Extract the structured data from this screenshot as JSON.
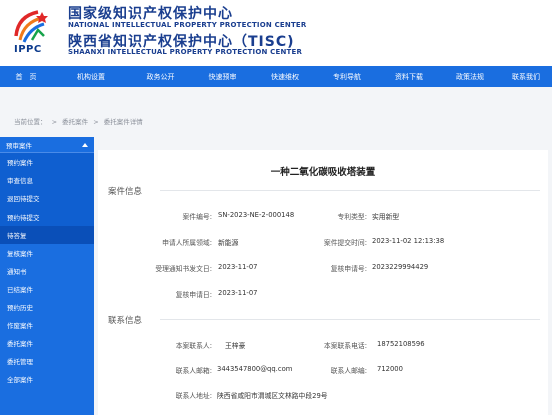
{
  "header": {
    "logo_text": "IPPC",
    "line1": "国家级知识产权保护中心",
    "line2": "NATIONAL INTELLECTUAL PROPERTY PROTECTION CENTER",
    "line3": "陕西省知识产权保护中心（TISC)",
    "line4": "SHAANXI INTELLECTUAL PROPERTY PROTECTION CENTER"
  },
  "nav": [
    "首　页",
    "机构设置",
    "政务公开",
    "快速预审",
    "快速维权",
    "专利导航",
    "资料下载",
    "政策法规",
    "联系我们"
  ],
  "breadcrumb": [
    "当前位置：",
    ">",
    "委托案件",
    ">",
    "委托案件详情"
  ],
  "sidebar": {
    "header": "预审案件",
    "sub_items": [
      "预约案件",
      "审查信息",
      "退回待提交",
      "预约待提交",
      "待答复"
    ],
    "items": [
      "复核案件",
      "通知书",
      "已结案件",
      "预约历史",
      "作废案件",
      "委托案件",
      "委托管理",
      "全部案件"
    ]
  },
  "content": {
    "title": "一种二氧化碳吸收塔装置",
    "case_section": "案件信息",
    "contact_section": "联系信息",
    "case_fields": {
      "case_no_label": "案件编号:",
      "case_no": "SN-2023-NE-2-000148",
      "patent_type_label": "专利类型:",
      "patent_type": "实用新型",
      "domain_label": "申请人所属领域:",
      "domain": "新能源",
      "submit_time_label": "案件提交时间:",
      "submit_time": "2023-11-02 12:13:38",
      "notice_date_label": "受理通知书发文日:",
      "notice_date": "2023-11-07",
      "review_no_label": "复核申请号:",
      "review_no": "2023229994429",
      "review_date_label": "复核申请日:",
      "review_date": "2023-11-07"
    },
    "contact_fields": {
      "person_label": "本案联系人:",
      "person": "王梓豪",
      "phone_label": "本案联系电话:",
      "phone": "18752108596",
      "email_label": "联系人邮箱:",
      "email": "3443547800@qq.com",
      "zip_label": "联系人邮编:",
      "zip": "712000",
      "address_label": "联系人地址:",
      "address": "陕西省咸阳市渭城区文林路中段29号"
    }
  }
}
